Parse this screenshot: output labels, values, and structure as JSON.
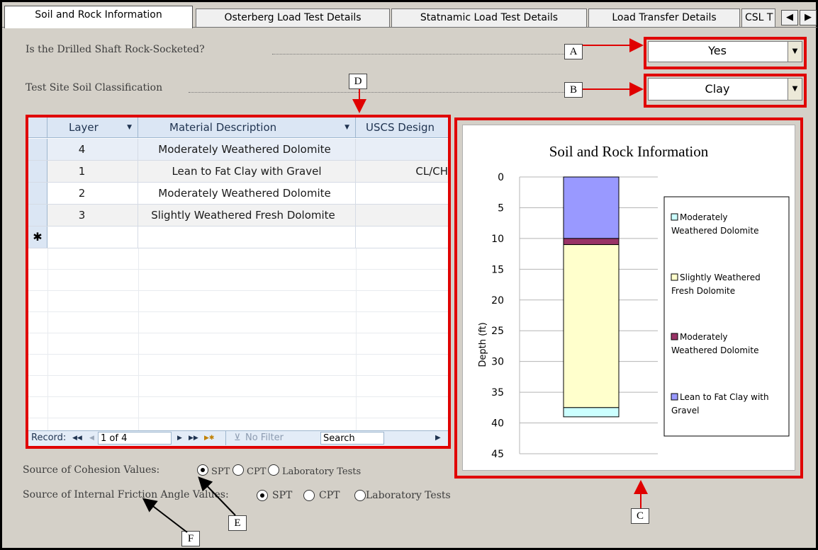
{
  "tabs": [
    {
      "label": "Soil and Rock Information",
      "active": true
    },
    {
      "label": "Osterberg Load Test Details"
    },
    {
      "label": "Statnamic Load Test Details"
    },
    {
      "label": "Load Transfer Details"
    },
    {
      "label": "CSL T"
    }
  ],
  "tab_nav": {
    "prev": "◀",
    "next": "▶"
  },
  "form": {
    "rock_socket_label": "Is the Drilled Shaft Rock-Socketed?",
    "rock_socket_value": "Yes",
    "soil_class_label": "Test Site Soil Classification",
    "soil_class_value": "Clay"
  },
  "callouts": {
    "a": "A",
    "b": "B",
    "c": "C",
    "d": "D",
    "e": "E",
    "f": "F"
  },
  "grid": {
    "columns": [
      "Layer",
      "Material Description",
      "USCS Design"
    ],
    "rows": [
      {
        "layer": "4",
        "material": "Moderately Weathered Dolomite",
        "uscs": ""
      },
      {
        "layer": "1",
        "material": "Lean to Fat Clay with Gravel",
        "uscs": "CL/CH"
      },
      {
        "layer": "2",
        "material": "Moderately Weathered Dolomite",
        "uscs": ""
      },
      {
        "layer": "3",
        "material": "Slightly Weathered Fresh Dolomite",
        "uscs": ""
      }
    ],
    "new_row_marker": "✱"
  },
  "record_nav": {
    "label": "Record:",
    "first": "◀◀",
    "prev": "◀",
    "position": "1 of 4",
    "next": "▶",
    "last": "▶▶",
    "new": "▶✱",
    "filter": "No Filter",
    "search": "Search",
    "scroll_right": "▶"
  },
  "chart_data": {
    "type": "bar",
    "title": "Soil and Rock Information",
    "ylabel": "Depth (ft)",
    "ylim": [
      0,
      45
    ],
    "yticks": [
      0,
      5,
      10,
      15,
      20,
      25,
      30,
      35,
      40,
      45
    ],
    "y_inverted": true,
    "grid": true,
    "legend_position": "right",
    "series": [
      {
        "name": "Lean to Fat Clay with Gravel",
        "top": 0,
        "bottom": 10,
        "color": "#9999ff"
      },
      {
        "name": "Moderately Weathered Dolomite",
        "top": 10,
        "bottom": 11,
        "color": "#993366"
      },
      {
        "name": "Slightly Weathered Fresh Dolomite",
        "top": 11,
        "bottom": 37.5,
        "color": "#ffffcc"
      },
      {
        "name": "Moderately Weathered Dolomite",
        "top": 37.5,
        "bottom": 39,
        "color": "#ccffff"
      }
    ],
    "legend": [
      {
        "label": "Moderately Weathered Dolomite",
        "color": "#ccffff"
      },
      {
        "label": "Slightly Weathered Fresh Dolomite",
        "color": "#ffffcc"
      },
      {
        "label": "Moderately Weathered Dolomite",
        "color": "#993366"
      },
      {
        "label": "Lean to Fat Clay with Gravel",
        "color": "#9999ff"
      }
    ]
  },
  "cohesion": {
    "label": "Source of Cohesion Values:",
    "options": [
      "SPT",
      "CPT",
      "Laboratory Tests"
    ],
    "selected": "SPT"
  },
  "friction": {
    "label": "Source of Internal Friction Angle Values:",
    "options": [
      "SPT",
      "CPT",
      "Laboratory Tests"
    ],
    "selected": "SPT"
  }
}
